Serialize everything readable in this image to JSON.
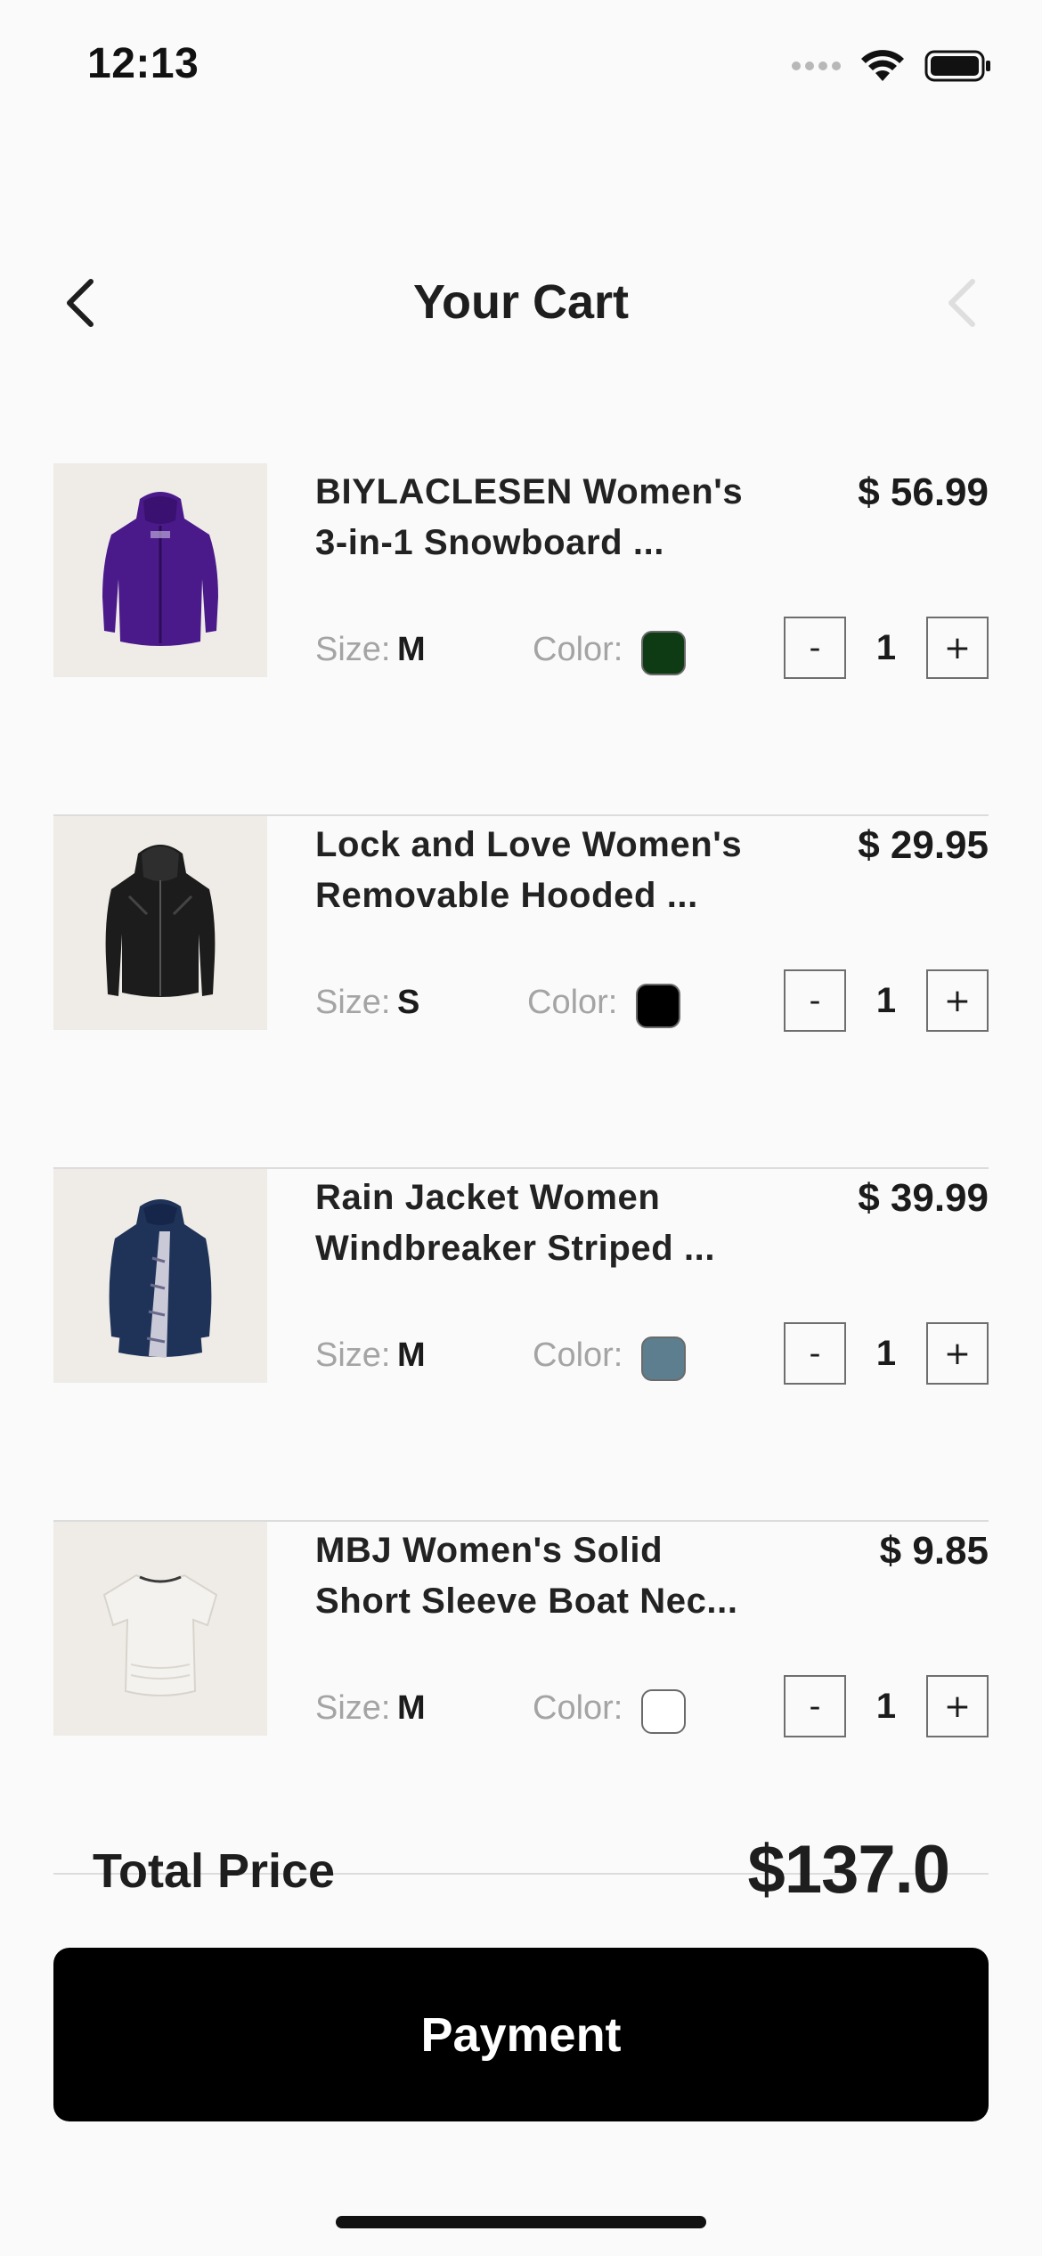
{
  "status_bar": {
    "time": "12:13"
  },
  "header": {
    "title": "Your Cart"
  },
  "cart": {
    "items": [
      {
        "name_line1": "BIYLACLESEN Women's",
        "name_line2": "3-in-1 Snowboard ...",
        "price": "$ 56.99",
        "size_label": "Size:",
        "size": "M",
        "color_label": "Color:",
        "color_hex": "#0e3b13",
        "quantity": "1",
        "minus": "-",
        "plus": "+",
        "image_icon": "purple-jacket-icon"
      },
      {
        "name_line1": "Lock and Love Women's",
        "name_line2": "Removable Hooded ...",
        "price": "$ 29.95",
        "size_label": "Size:",
        "size": "S",
        "color_label": "Color:",
        "color_hex": "#000000",
        "quantity": "1",
        "minus": "-",
        "plus": "+",
        "image_icon": "black-leather-jacket-icon"
      },
      {
        "name_line1": "Rain Jacket Women",
        "name_line2": "Windbreaker Striped ...",
        "price": "$ 39.99",
        "size_label": "Size:",
        "size": "M",
        "color_label": "Color:",
        "color_hex": "#5d7e8f",
        "quantity": "1",
        "minus": "-",
        "plus": "+",
        "image_icon": "navy-raincoat-icon"
      },
      {
        "name_line1": "MBJ Women's Solid",
        "name_line2": "Short Sleeve Boat Nec...",
        "price": "$ 9.85",
        "size_label": "Size:",
        "size": "M",
        "color_label": "Color:",
        "color_hex": "#ffffff",
        "quantity": "1",
        "minus": "-",
        "plus": "+",
        "image_icon": "white-tshirt-icon"
      }
    ]
  },
  "total": {
    "label": "Total Price",
    "value": "$137.0"
  },
  "payment": {
    "label": "Payment"
  }
}
